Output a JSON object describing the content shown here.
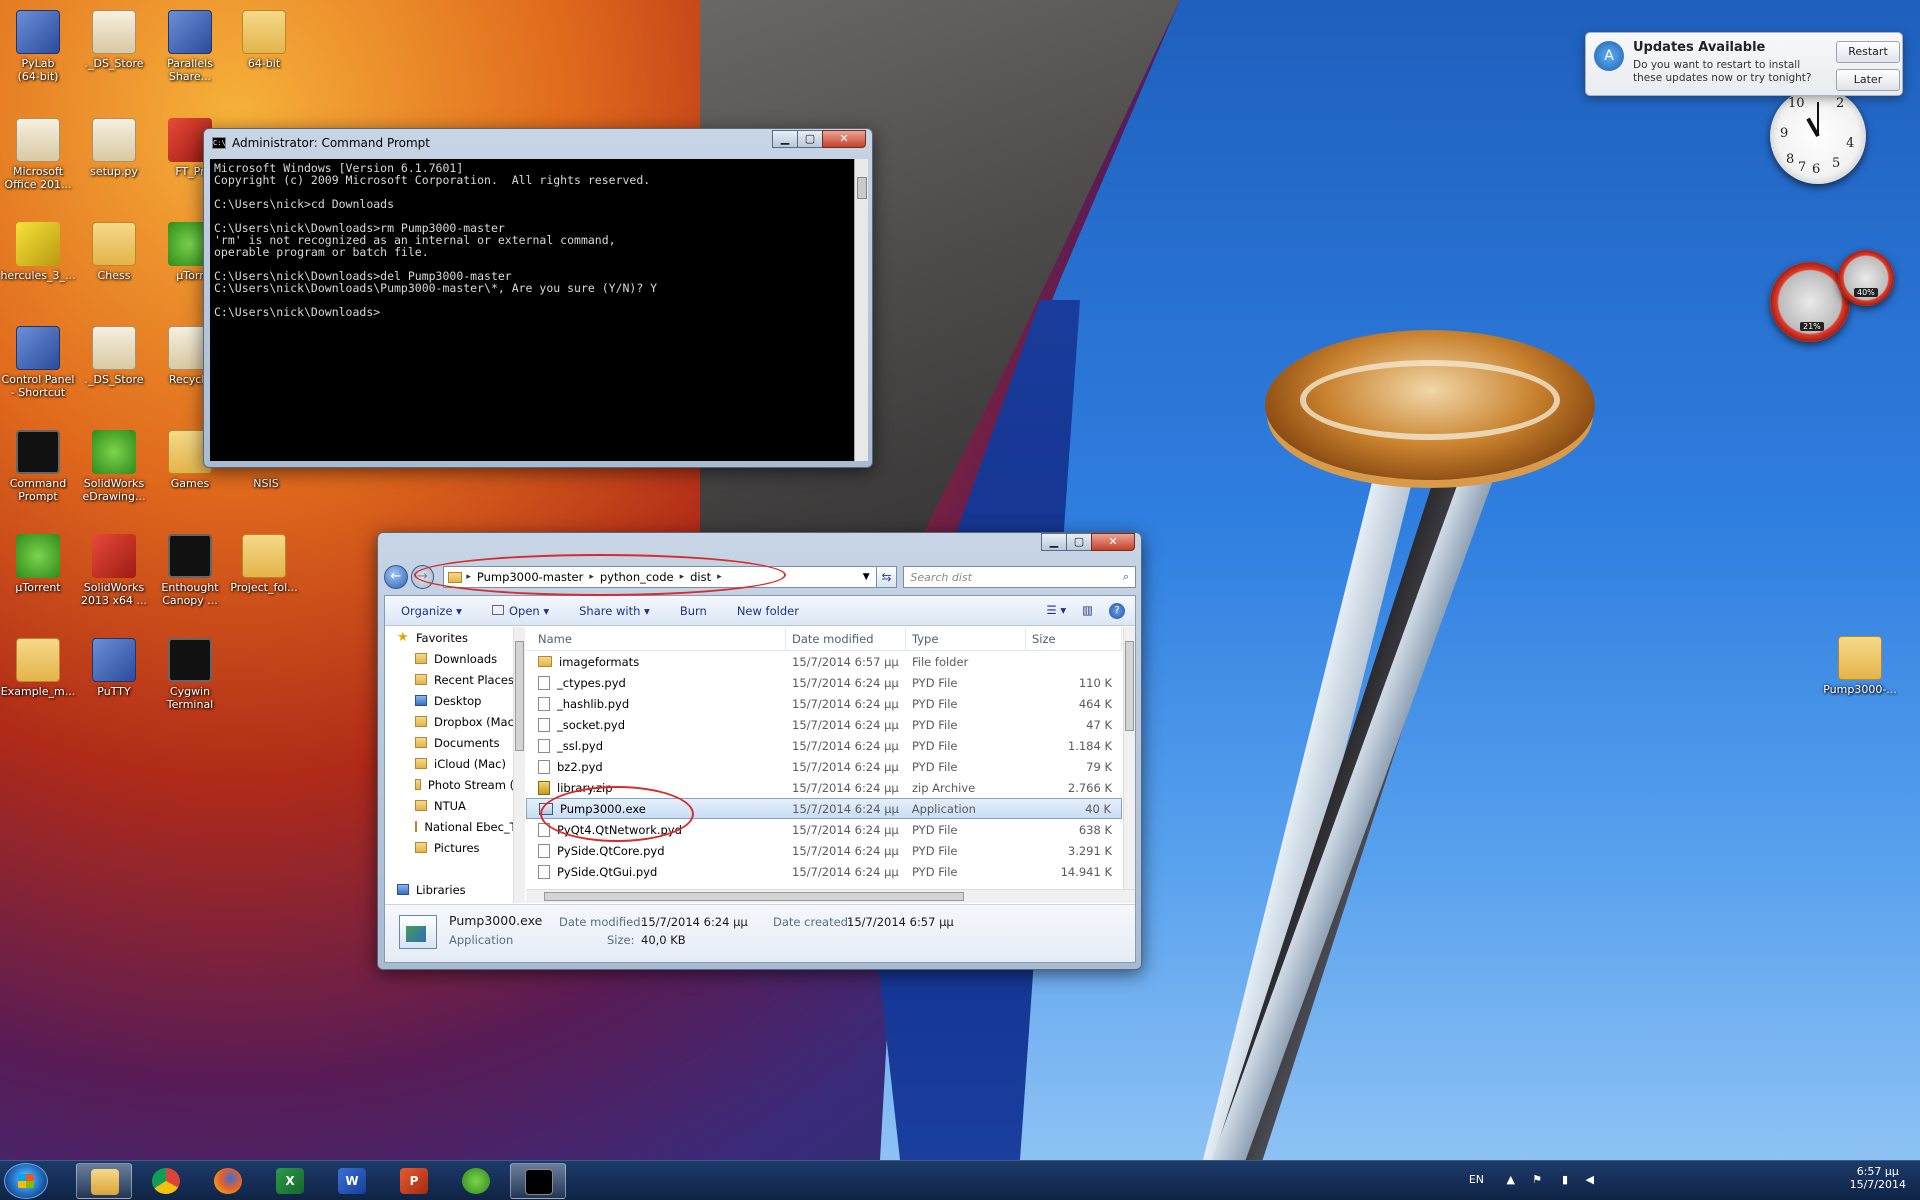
{
  "desktop": {
    "icons": [
      {
        "id": "pylab",
        "label": "PyLab\n(64-bit)"
      },
      {
        "id": "ds-store-1",
        "label": "._DS_Store"
      },
      {
        "id": "parallels-share",
        "label": "Parallels\nShare..."
      },
      {
        "id": "64-bit",
        "label": "64-bit"
      },
      {
        "id": "ms-office",
        "label": "Microsoft\nOffice 201..."
      },
      {
        "id": "setup-py",
        "label": "setup.py"
      },
      {
        "id": "ft-pr",
        "label": "FT_Pr"
      },
      {
        "id": "hercules",
        "label": "hercules_3_..."
      },
      {
        "id": "chess",
        "label": "Chess"
      },
      {
        "id": "utorrent-1",
        "label": "µTorr"
      },
      {
        "id": "control-panel",
        "label": "Control Panel\n- Shortcut"
      },
      {
        "id": "ds-store-2",
        "label": "._DS_Store"
      },
      {
        "id": "recycle",
        "label": "Recycle"
      },
      {
        "id": "command-prompt",
        "label": "Command\nPrompt"
      },
      {
        "id": "solidworks-edrawing",
        "label": "SolidWorks\neDrawing..."
      },
      {
        "id": "games",
        "label": "Games"
      },
      {
        "id": "nsis",
        "label": "NSIS"
      },
      {
        "id": "utorrent-2",
        "label": "µTorrent"
      },
      {
        "id": "solidworks-2013",
        "label": "SolidWorks\n2013 x64 ..."
      },
      {
        "id": "enthought",
        "label": "Enthought\nCanopy ..."
      },
      {
        "id": "project-fol",
        "label": "Project_fol..."
      },
      {
        "id": "example-m",
        "label": "Example_m..."
      },
      {
        "id": "putty",
        "label": "PuTTY"
      },
      {
        "id": "cygwin",
        "label": "Cygwin\nTerminal"
      },
      {
        "id": "pump3000-desktop",
        "label": "Pump3000-..."
      }
    ]
  },
  "cmd": {
    "title": "Administrator: Command Prompt",
    "lines": "Microsoft Windows [Version 6.1.7601]\nCopyright (c) 2009 Microsoft Corporation.  All rights reserved.\n\nC:\\Users\\nick>cd Downloads\n\nC:\\Users\\nick\\Downloads>rm Pump3000-master\n'rm' is not recognized as an internal or external command,\noperable program or batch file.\n\nC:\\Users\\nick\\Downloads>del Pump3000-master\nC:\\Users\\nick\\Downloads\\Pump3000-master\\*, Are you sure (Y/N)? Y\n\nC:\\Users\\nick\\Downloads>"
  },
  "explorer": {
    "breadcrumb": [
      "Pump3000-master",
      "python_code",
      "dist"
    ],
    "search_placeholder": "Search dist",
    "toolbar": {
      "organize": "Organize",
      "open": "Open",
      "share": "Share with",
      "burn": "Burn",
      "new_folder": "New folder"
    },
    "nav": [
      {
        "label": "Favorites",
        "kind": "head"
      },
      {
        "label": "Downloads",
        "kind": "item"
      },
      {
        "label": "Recent Places",
        "kind": "item"
      },
      {
        "label": "Desktop",
        "kind": "item"
      },
      {
        "label": "Dropbox (Mac)",
        "kind": "item"
      },
      {
        "label": "Documents",
        "kind": "item"
      },
      {
        "label": "iCloud (Mac)",
        "kind": "item"
      },
      {
        "label": "Photo Stream (M",
        "kind": "item"
      },
      {
        "label": "NTUA",
        "kind": "item"
      },
      {
        "label": "National Ebec_Th",
        "kind": "item"
      },
      {
        "label": "Pictures",
        "kind": "item"
      },
      {
        "label": "",
        "kind": "spacer"
      },
      {
        "label": "Libraries",
        "kind": "head"
      }
    ],
    "columns": {
      "name": "Name",
      "date": "Date modified",
      "type": "Type",
      "size": "Size"
    },
    "files": [
      {
        "name": "imageformats",
        "date": "15/7/2014 6:57 μμ",
        "type": "File folder",
        "size": "",
        "icon": "folder"
      },
      {
        "name": "_ctypes.pyd",
        "date": "15/7/2014 6:24 μμ",
        "type": "PYD File",
        "size": "110 K",
        "icon": "file"
      },
      {
        "name": "_hashlib.pyd",
        "date": "15/7/2014 6:24 μμ",
        "type": "PYD File",
        "size": "464 K",
        "icon": "file"
      },
      {
        "name": "_socket.pyd",
        "date": "15/7/2014 6:24 μμ",
        "type": "PYD File",
        "size": "47 K",
        "icon": "file"
      },
      {
        "name": "_ssl.pyd",
        "date": "15/7/2014 6:24 μμ",
        "type": "PYD File",
        "size": "1.184 K",
        "icon": "file"
      },
      {
        "name": "bz2.pyd",
        "date": "15/7/2014 6:24 μμ",
        "type": "PYD File",
        "size": "79 K",
        "icon": "file"
      },
      {
        "name": "library.zip",
        "date": "15/7/2014 6:24 μμ",
        "type": "zip Archive",
        "size": "2.766 K",
        "icon": "zip"
      },
      {
        "name": "Pump3000.exe",
        "date": "15/7/2014 6:24 μμ",
        "type": "Application",
        "size": "40 K",
        "icon": "exe",
        "selected": true
      },
      {
        "name": "PyQt4.QtNetwork.pyd",
        "date": "15/7/2014 6:24 μμ",
        "type": "PYD File",
        "size": "638 K",
        "icon": "file"
      },
      {
        "name": "PySide.QtCore.pyd",
        "date": "15/7/2014 6:24 μμ",
        "type": "PYD File",
        "size": "3.291 K",
        "icon": "file"
      },
      {
        "name": "PySide.QtGui.pyd",
        "date": "15/7/2014 6:24 μμ",
        "type": "PYD File",
        "size": "14.941 K",
        "icon": "file"
      }
    ],
    "details": {
      "name": "Pump3000.exe",
      "type": "Application",
      "modified_label": "Date modified:",
      "modified": "15/7/2014 6:24 μμ",
      "created_label": "Date created:",
      "created": "15/7/2014 6:57 μμ",
      "size_label": "Size:",
      "size": "40,0 KB"
    }
  },
  "notification": {
    "title": "Updates Available",
    "message": "Do you want to restart to install these updates now or try tonight?",
    "restart": "Restart",
    "later": "Later"
  },
  "gadgets": {
    "clock_numbers": [
      "10",
      "2",
      "9",
      "4",
      "8",
      "6",
      "5",
      "7"
    ],
    "cpu": "21%",
    "mem": "40%"
  },
  "taskbar": {
    "language": "EN",
    "time": "6:57 μμ",
    "date": "15/7/2014"
  }
}
